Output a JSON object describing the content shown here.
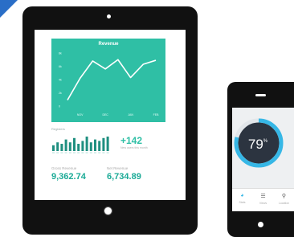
{
  "tablet": {
    "chart": {
      "title": "Revenue",
      "y_ticks": [
        "8k",
        "6k",
        "4k",
        "2k",
        "0"
      ],
      "x_ticks": [
        "NOV",
        "DEC",
        "JAN",
        "FEB"
      ]
    },
    "kpi": {
      "label": "Registers",
      "value": "+142",
      "sub": "New users this month"
    },
    "gross": {
      "label": "Gross Revenue",
      "value": "9,362.74"
    },
    "net": {
      "label": "Net Revenue",
      "value": "6,734.89"
    }
  },
  "phone": {
    "gauge": {
      "value": "79",
      "unit": "%"
    },
    "tabs": [
      {
        "label": "Stats",
        "icon": "pie-icon"
      },
      {
        "label": "Views",
        "icon": "list-icon"
      },
      {
        "label": "Location",
        "icon": "pin-icon"
      }
    ]
  },
  "colors": {
    "accent": "#2fbfa5",
    "gauge_bg": "#2c3440",
    "brand_corner": "#2a6ec7"
  },
  "chart_data": {
    "type": "line",
    "title": "Revenue",
    "x": [
      "",
      "NOV",
      "",
      "DEC",
      "",
      "JAN",
      "",
      "FEB"
    ],
    "series": [
      {
        "values": [
          0.9,
          4.2,
          6.8,
          5.6,
          7.0,
          4.3,
          6.3,
          6.9
        ]
      }
    ],
    "ylim": [
      0,
      8
    ],
    "ylabel": "",
    "xlabel": ""
  },
  "bar_data": {
    "type": "bar",
    "values": [
      4,
      6,
      5,
      8,
      6,
      9,
      5,
      7,
      10,
      6,
      8,
      7,
      9,
      10
    ],
    "ylim": [
      0,
      10
    ]
  }
}
